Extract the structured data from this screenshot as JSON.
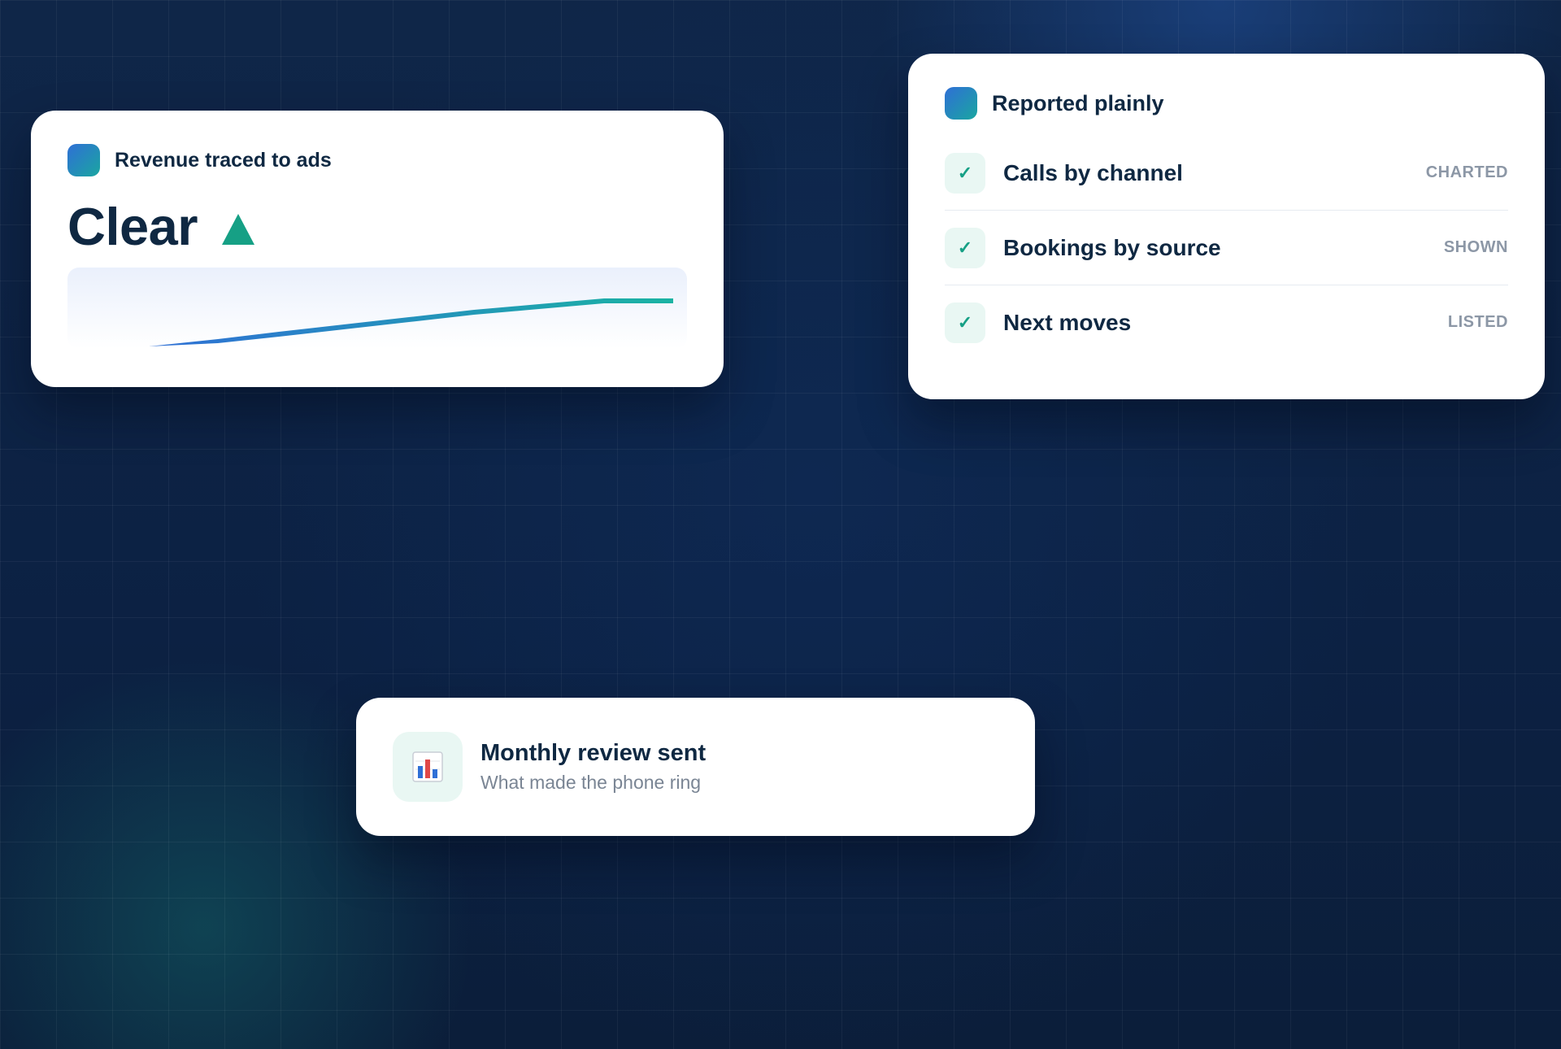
{
  "revenue_card": {
    "title": "Revenue traced to ads",
    "headline": "Clear",
    "trend_icon": "triangle-up-icon",
    "accent": "#16a085",
    "line_gradient": [
      "#2f6fd6",
      "#1ab3a3"
    ]
  },
  "report_card": {
    "title": "Reported plainly",
    "items": [
      {
        "label": "Calls by channel",
        "status": "CHARTED",
        "icon": "check-icon"
      },
      {
        "label": "Bookings by source",
        "status": "SHOWN",
        "icon": "check-icon"
      },
      {
        "label": "Next moves",
        "status": "LISTED",
        "icon": "check-icon"
      }
    ]
  },
  "monthly_card": {
    "icon": "bar-chart-icon",
    "title": "Monthly review sent",
    "subtitle": "What made the phone ring"
  },
  "colors": {
    "background": "#0d2240",
    "text_primary": "#0f2842",
    "text_muted": "#8c97a6",
    "check_green": "#16a085"
  }
}
